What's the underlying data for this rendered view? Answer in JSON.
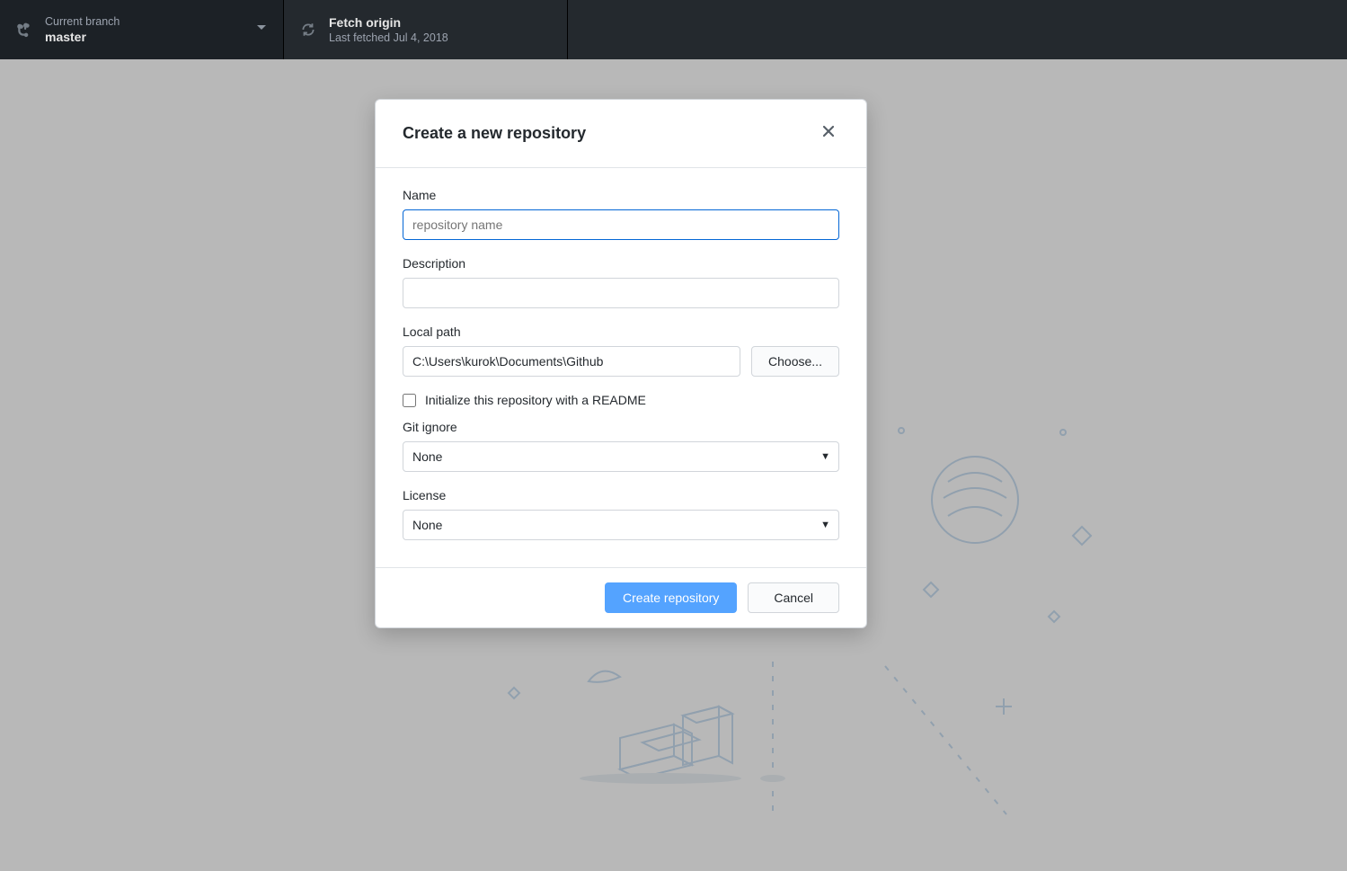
{
  "toolbar": {
    "branch_label": "Current branch",
    "branch_value": "master",
    "fetch_label": "Fetch origin",
    "fetch_sub": "Last fetched Jul 4, 2018"
  },
  "dialog": {
    "title": "Create a new repository",
    "name_label": "Name",
    "name_placeholder": "repository name",
    "name_value": "",
    "description_label": "Description",
    "description_value": "",
    "local_path_label": "Local path",
    "local_path_value": "C:\\Users\\kurok\\Documents\\Github",
    "choose_label": "Choose...",
    "readme_label": "Initialize this repository with a README",
    "gitignore_label": "Git ignore",
    "gitignore_value": "None",
    "license_label": "License",
    "license_value": "None",
    "create_button": "Create repository",
    "cancel_button": "Cancel"
  }
}
